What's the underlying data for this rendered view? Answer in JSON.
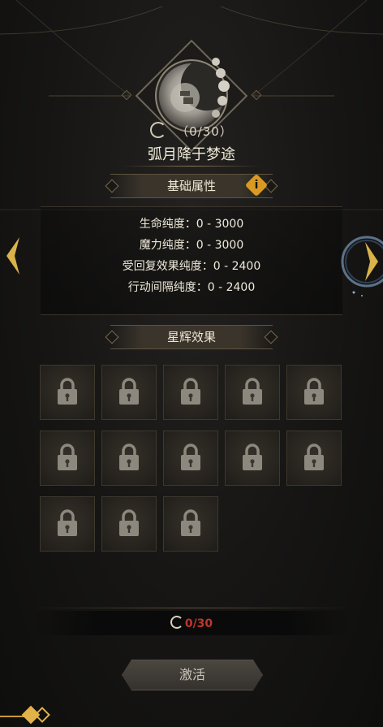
{
  "header": {
    "progress_text": "（0/30）",
    "title": "弧月降于梦途"
  },
  "basic_attributes": {
    "label": "基础属性",
    "info_icon_text": "i",
    "stats": [
      "生命纯度：0 - 3000",
      "魔力纯度：0 - 3000",
      "受回复效果纯度：0 - 2400",
      "行动间隔纯度：0 - 2400"
    ]
  },
  "star_effects": {
    "label": "星辉效果",
    "slots": [
      {
        "state": "locked"
      },
      {
        "state": "locked"
      },
      {
        "state": "locked"
      },
      {
        "state": "locked"
      },
      {
        "state": "locked"
      },
      {
        "state": "locked"
      },
      {
        "state": "locked"
      },
      {
        "state": "locked"
      },
      {
        "state": "locked"
      },
      {
        "state": "locked"
      },
      {
        "state": "locked"
      },
      {
        "state": "locked"
      },
      {
        "state": "locked"
      }
    ]
  },
  "cost": {
    "text": "0/30",
    "color": "#c0352b"
  },
  "activate_button": {
    "label": "激活"
  },
  "icons": [
    "moon-emblem-icon",
    "progress-ring-icon",
    "info-icon",
    "chevron-left-icon",
    "chevron-right-icon",
    "lock-icon",
    "corner-badge-icon"
  ]
}
